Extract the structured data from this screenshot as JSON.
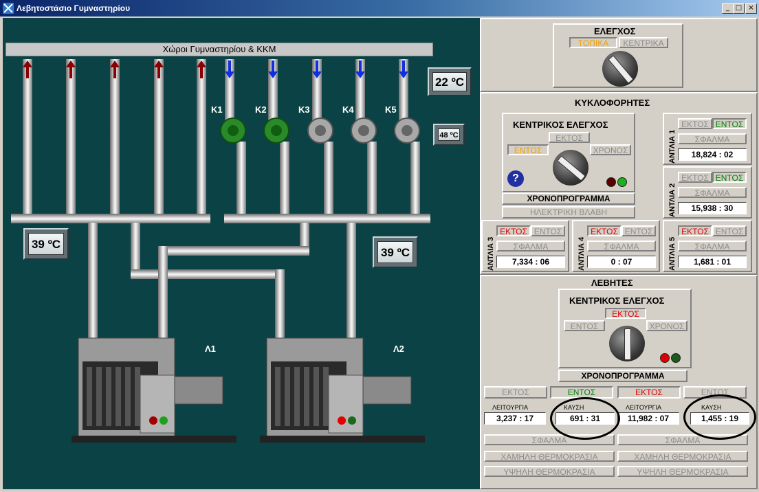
{
  "window": {
    "title": "Λεβητοστάσιο Γυμναστηρίου",
    "controls": [
      "_",
      "□",
      "×"
    ]
  },
  "plant": {
    "header_bar": "Χώροι Γυμναστηρίου & ΚΚΜ",
    "temp_top": "22 ºC",
    "temp_mid": "48 ºC",
    "temp_left": "39 ºC",
    "temp_right": "39 ºC",
    "pumps": [
      "Κ1",
      "Κ2",
      "Κ3",
      "Κ4",
      "Κ5"
    ],
    "boilers": [
      "Λ1",
      "Λ2"
    ]
  },
  "control": {
    "title": "ΕΛΕΓΧΟΣ",
    "local": "ΤΟΠΙΚΑ",
    "central": "ΚΕΝΤΡΙΚΑ"
  },
  "circulators": {
    "title": "ΚΥΚΛΟΦΟΡΗΤΕΣ",
    "central_title": "ΚΕΝΤΡΙΚΟΣ ΕΛΕΓΧΟΣ",
    "off": "ΕΚΤΟΣ",
    "on": "ΕΝΤΟΣ",
    "timer": "ΧΡΟΝΟΣ",
    "help": "?",
    "schedule": "ΧΡΟΝΟΠΡΟΓΡΑΜΜΑ",
    "electric_fault": "ΗΛΕΚΤΡΙΚΗ ΒΛΑΒΗ",
    "pumps": [
      {
        "label": "ΑΝΤΛΙΑ 1",
        "off": "ΕΚΤΟΣ",
        "on": "ΕΝΤΟΣ",
        "fault": "ΣΦΑΛΜΑ",
        "hours": "18,824 : 02"
      },
      {
        "label": "ΑΝΤΛΙΑ 2",
        "off": "ΕΚΤΟΣ",
        "on": "ΕΝΤΟΣ",
        "fault": "ΣΦΑΛΜΑ",
        "hours": "15,938 : 30"
      },
      {
        "label": "ΑΝΤΛΙΑ 3",
        "off": "ΕΚΤΟΣ",
        "on": "ΕΝΤΟΣ",
        "fault": "ΣΦΑΛΜΑ",
        "hours": "7,334 : 06"
      },
      {
        "label": "ΑΝΤΛΙΑ 4",
        "off": "ΕΚΤΟΣ",
        "on": "ΕΝΤΟΣ",
        "fault": "ΣΦΑΛΜΑ",
        "hours": "0 : 07"
      },
      {
        "label": "ΑΝΤΛΙΑ 5",
        "off": "ΕΚΤΟΣ",
        "on": "ΕΝΤΟΣ",
        "fault": "ΣΦΑΛΜΑ",
        "hours": "1,681 : 01"
      }
    ]
  },
  "boilers": {
    "title": "ΛΕΒΗΤΕΣ",
    "central_title": "ΚΕΝΤΡΙΚΟΣ ΕΛΕΓΧΟΣ",
    "off": "ΕΚΤΟΣ",
    "on": "ΕΝΤΟΣ",
    "timer": "ΧΡΟΝΟΣ",
    "schedule": "ΧΡΟΝΟΠΡΟΓΡΑΜΜΑ",
    "units": [
      {
        "off": "ΕΚΤΟΣ",
        "on": "ΕΝΤΟΣ",
        "operation_label": "ΛΕΙΤΟΥΡΓΙΑ",
        "operation": "3,237 : 17",
        "burn_label": "ΚΑΥΣΗ",
        "burn": "691 : 31",
        "fault": "ΣΦΑΛΜΑ",
        "low_temp": "ΧΑΜΗΛΗ ΘΕΡΜΟΚΡΑΣΙΑ",
        "high_temp": "ΥΨΗΛΗ ΘΕΡΜΟΚΡΑΣΙΑ"
      },
      {
        "off": "ΕΚΤΟΣ",
        "on": "ΕΝΤΟΣ",
        "operation_label": "ΛΕΙΤΟΥΡΓΙΑ",
        "operation": "11,982 : 07",
        "burn_label": "ΚΑΥΣΗ",
        "burn": "1,455 : 19",
        "fault": "ΣΦΑΛΜΑ",
        "low_temp": "ΧΑΜΗΛΗ ΘΕΡΜΟΚΡΑΣΙΑ",
        "high_temp": "ΥΨΗΛΗ ΘΕΡΜΟΚΡΑΣΙΑ"
      }
    ]
  },
  "colors": {
    "canvas": "#0b4245",
    "active_red": "#e00000",
    "active_green": "#008000",
    "active_orange": "#f0a000"
  }
}
